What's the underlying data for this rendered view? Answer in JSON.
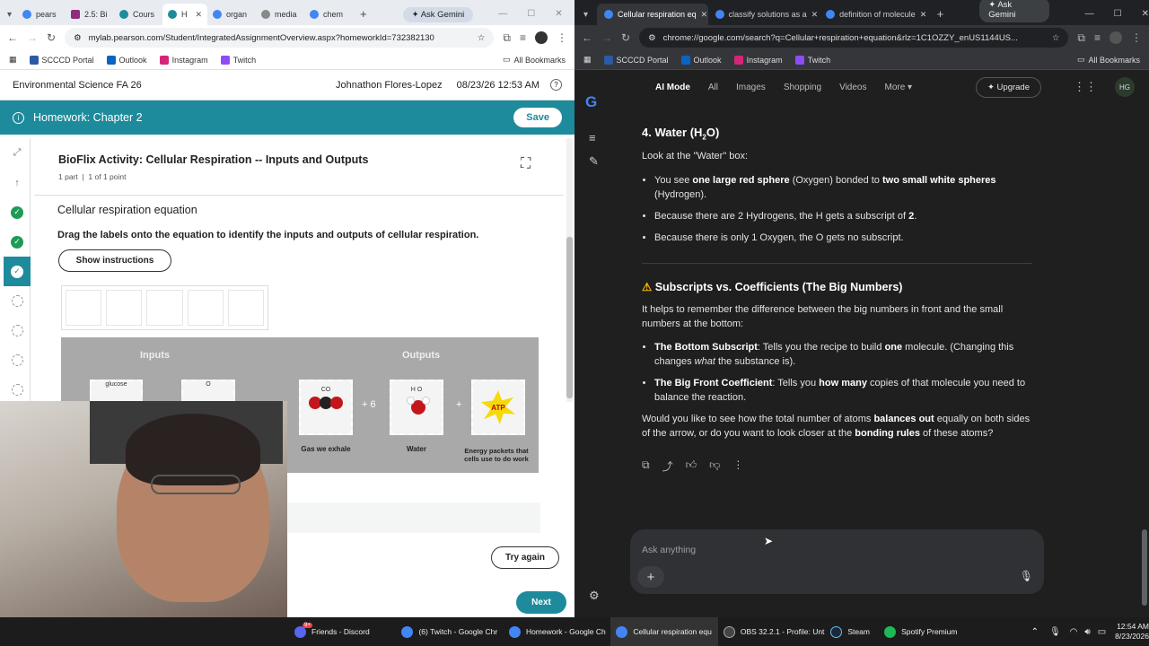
{
  "left_browser": {
    "tabs": [
      "pears",
      "2.5: Bi",
      "Cours",
      "H",
      "organ",
      "media",
      "chem"
    ],
    "ask_gemini": "Ask Gemini",
    "url": "mylab.pearson.com/Student/IntegratedAssignmentOverview.aspx?homeworkId=732382130",
    "bookmarks": [
      "SCCCD Portal",
      "Outlook",
      "Instagram",
      "Twitch"
    ],
    "all_bookmarks": "All Bookmarks"
  },
  "pearson": {
    "course": "Environmental Science FA 26",
    "student": "Johnathon Flores-Lopez",
    "datetime": "08/23/26 12:53 AM",
    "hw_title": "Homework: Chapter 2",
    "save": "Save",
    "activity_title": "BioFlix Activity: Cellular Respiration -- Inputs and Outputs",
    "part": "1 part",
    "points": "1 of 1 point",
    "section_title": "Cellular respiration equation",
    "instruction": "Drag the labels onto the equation to identify the inputs and outputs of cellular respiration.",
    "show_instructions": "Show instructions",
    "inputs_label": "Inputs",
    "outputs_label": "Outputs",
    "glucose": "glucose",
    "o2": "O",
    "co2": "CO",
    "h2o": "H O",
    "atp": "ATP",
    "plus6": "+ 6",
    "plus": "+",
    "gas_label": "Gas we exhale",
    "water_label": "Water",
    "energy_label": "Energy packets that cells use to do work",
    "try_again": "Try again",
    "next": "Next"
  },
  "right_browser": {
    "tabs": [
      "Cellular respiration eq",
      "classify solutions as a",
      "definition of molecule"
    ],
    "ask_gemini": "Ask Gemini",
    "url": "chrome://google.com/search?q=Cellular+respiration+equation&rlz=1C1OZZY_enUS1144US...",
    "bookmarks": [
      "SCCCD Portal",
      "Outlook",
      "Instagram",
      "Twitch"
    ],
    "all_bookmarks": "All Bookmarks",
    "nav": [
      "AI Mode",
      "All",
      "Images",
      "Shopping",
      "Videos",
      "More"
    ],
    "upgrade": "Upgrade",
    "avatar": "HG"
  },
  "answer": {
    "water_heading": "4. Water (H",
    "water_heading_sub": "2",
    "water_heading_end": "O)",
    "look": "Look at the \"Water\" box:",
    "b1_pre": "You see ",
    "b1_bold1": "one large red sphere",
    "b1_mid": " (Oxygen) bonded to ",
    "b1_bold2": "two small white spheres",
    "b1_end": " (Hydrogen).",
    "b2_pre": "Because there are 2 Hydrogens, the H gets a subscript of ",
    "b2_bold": "2",
    "b2_end": ".",
    "b3": "Because there is only 1 Oxygen, the O gets no subscript.",
    "warn_heading": "Subscripts vs. Coefficients (The Big Numbers)",
    "intro": "It helps to remember the difference between the big numbers in front and the small numbers at the bottom:",
    "c1_bold": "The Bottom Subscript",
    "c1_a": ": Tells you the recipe to build ",
    "c1_bold2": "one",
    "c1_b": " molecule. (Changing this changes ",
    "c1_it": "what",
    "c1_c": " the substance is).",
    "c2_bold": "The Big Front Coefficient",
    "c2_a": ": Tells you ",
    "c2_bold2": "how many",
    "c2_b": " copies of that molecule you need to balance the reaction.",
    "q_a": "Would you like to see how the total number of atoms ",
    "q_bold1": "balances out",
    "q_b": " equally on both sides of the arrow, or do you want to look closer at the ",
    "q_bold2": "bonding rules",
    "q_c": " of these atoms?",
    "ask_placeholder": "Ask anything"
  },
  "taskbar": {
    "items": [
      "Friends - Discord",
      "(6) Twitch - Google Chr",
      "Homework - Google Ch",
      "Cellular respiration equ",
      "OBS 32.2.1 - Profile: Unt",
      "Steam",
      "Spotify Premium"
    ],
    "time": "12:54 AM",
    "date": "8/23/2026",
    "discord_badge": "9+"
  }
}
